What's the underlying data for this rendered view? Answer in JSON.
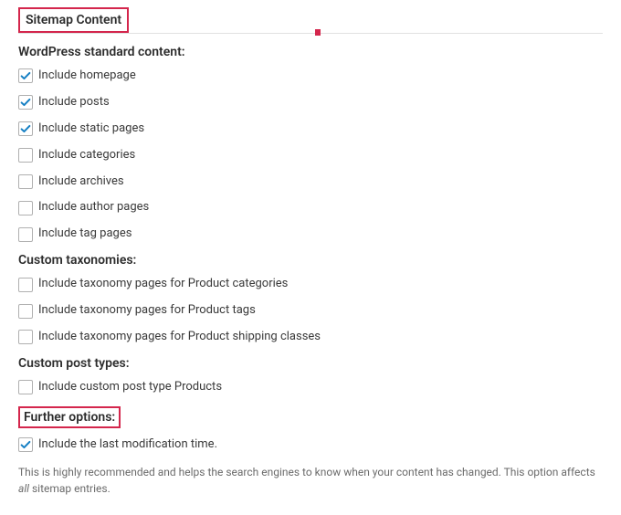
{
  "panel": {
    "title": "Sitemap Content"
  },
  "groups": {
    "standard": {
      "heading": "WordPress standard content:",
      "options": [
        {
          "label": "Include homepage",
          "checked": true
        },
        {
          "label": "Include posts",
          "checked": true
        },
        {
          "label": "Include static pages",
          "checked": true
        },
        {
          "label": "Include categories",
          "checked": false
        },
        {
          "label": "Include archives",
          "checked": false
        },
        {
          "label": "Include author pages",
          "checked": false
        },
        {
          "label": "Include tag pages",
          "checked": false
        }
      ]
    },
    "taxonomies": {
      "heading": "Custom taxonomies:",
      "options": [
        {
          "label": "Include taxonomy pages for Product categories",
          "checked": false
        },
        {
          "label": "Include taxonomy pages for Product tags",
          "checked": false
        },
        {
          "label": "Include taxonomy pages for Product shipping classes",
          "checked": false
        }
      ]
    },
    "post_types": {
      "heading": "Custom post types:",
      "options": [
        {
          "label": "Include custom post type Products",
          "checked": false
        }
      ]
    },
    "further": {
      "heading": "Further options:",
      "options": [
        {
          "label": "Include the last modification time.",
          "checked": true
        }
      ],
      "help_pre": "This is highly recommended and helps the search engines to know when your content has changed. This option affects ",
      "help_italic": "all",
      "help_post": " sitemap entries."
    }
  }
}
